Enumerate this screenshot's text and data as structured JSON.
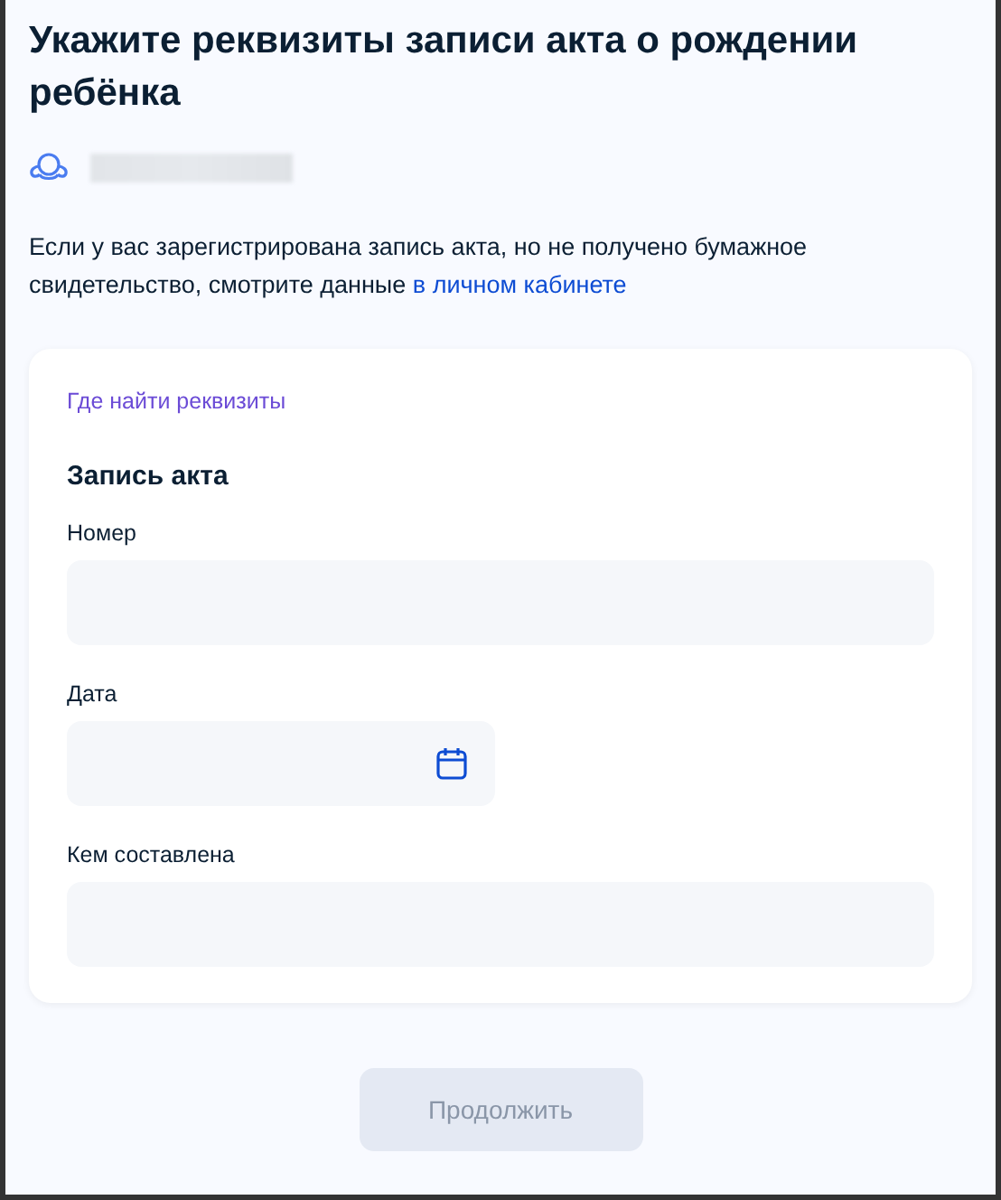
{
  "title": "Укажите реквизиты записи акта о рождении ребёнка",
  "notice": {
    "text": "Если у вас зарегистрирована запись акта, но не получено бумажное свидетельство, смотрите данные ",
    "link": "в личном кабинете"
  },
  "form": {
    "help_link": "Где найти реквизиты",
    "section_title": "Запись акта",
    "fields": [
      {
        "label": "Номер",
        "kind": "text"
      },
      {
        "label": "Дата",
        "kind": "date"
      },
      {
        "label": "Кем составлена",
        "kind": "text"
      }
    ]
  },
  "continue_button": {
    "label": "Продолжить",
    "disabled": true
  }
}
